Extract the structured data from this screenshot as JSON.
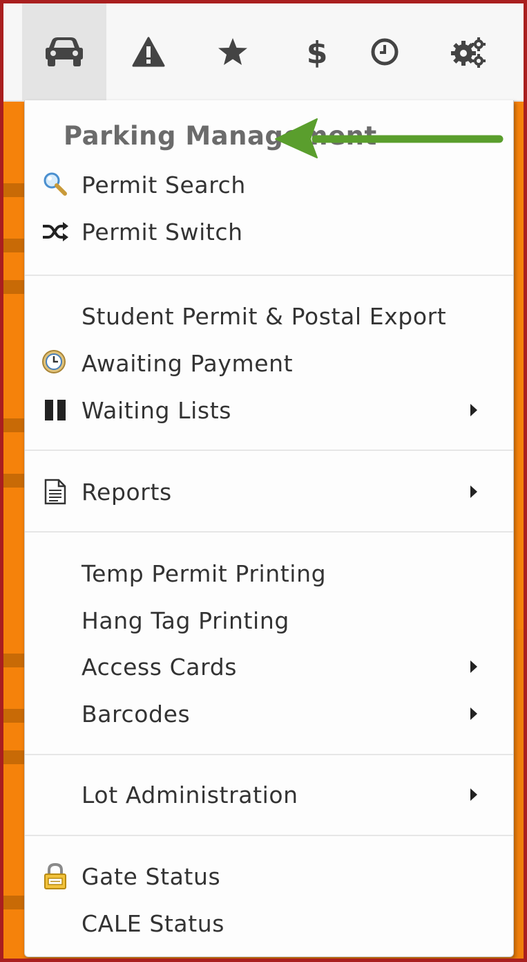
{
  "toolbar": {
    "buttons": [
      {
        "icon": "car-icon",
        "active": true
      },
      {
        "icon": "warning-icon"
      },
      {
        "icon": "star-icon"
      },
      {
        "icon": "dollar-icon"
      },
      {
        "icon": "clock-icon"
      },
      {
        "icon": "gears-icon"
      }
    ]
  },
  "menu": {
    "title": "Parking Management",
    "items": {
      "permit_search": "Permit Search",
      "permit_switch": "Permit Switch",
      "student_export": "Student Permit & Postal Export",
      "awaiting_payment": "Awaiting Payment",
      "waiting_lists": "Waiting Lists",
      "reports": "Reports",
      "temp_permit": "Temp Permit Printing",
      "hang_tag": "Hang Tag Printing",
      "access_cards": "Access Cards",
      "barcodes": "Barcodes",
      "lot_admin": "Lot Administration",
      "gate_status": "Gate Status",
      "cale_status": "CALE Status"
    }
  },
  "colors": {
    "accent_orange": "#f5820b",
    "frame_red": "#a91f1f",
    "arrow_green": "#5a9e2d"
  }
}
